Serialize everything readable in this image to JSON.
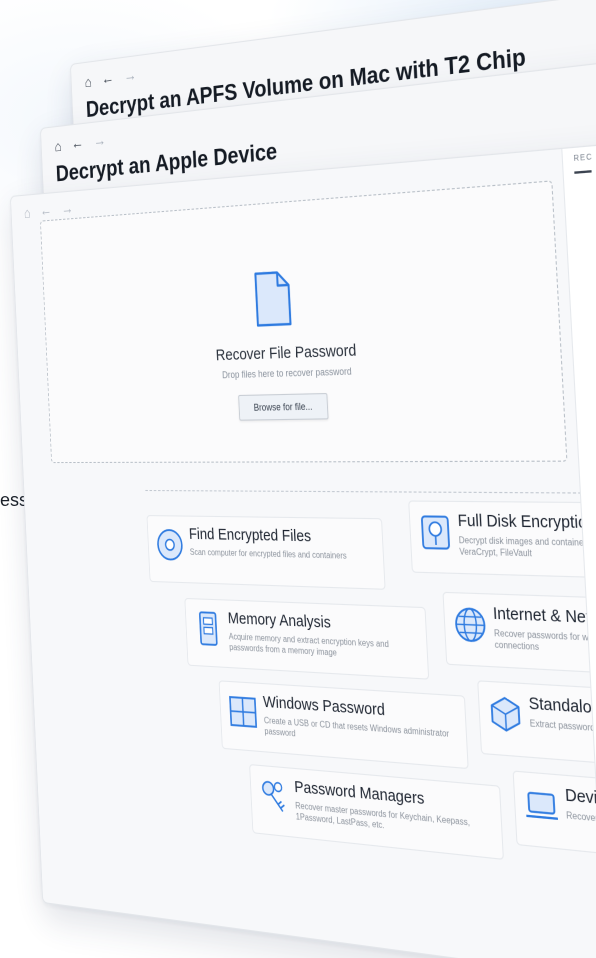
{
  "windows": [
    {
      "title": "Decrypt an APFS Volume on Mac with T2 Chip",
      "nav": {
        "home": "⌂",
        "back": "←",
        "forward": "→"
      }
    },
    {
      "title": "Decrypt an Apple Device",
      "nav": {
        "home": "⌂",
        "back": "←",
        "forward": "→"
      }
    }
  ],
  "main_window": {
    "nav": {
      "home": "⌂",
      "back": "←",
      "forward": "→"
    },
    "drop_zone": {
      "title": "Recover File Password",
      "subtitle": "Drop files here to recover password",
      "browse_label": "Browse for file..."
    },
    "right_panel_caption": "REC",
    "tiles": [
      {
        "name": "Find Encrypted Files",
        "desc": "Scan computer for encrypted files and containers",
        "icon": "disc-icon"
      },
      {
        "name": "Full Disk Encryption",
        "desc": "Decrypt disk images and containers: BitLocker, VeraCrypt, FileVault",
        "icon": "disk-lock-icon"
      },
      {
        "name": "Memory Analysis",
        "desc": "Acquire memory and extract encryption keys and passwords from a memory image",
        "icon": "memory-chip-icon"
      },
      {
        "name": "Internet & Network",
        "desc": "Recover passwords for web browsers and network connections",
        "icon": "globe-icon"
      },
      {
        "name": "Windows Password",
        "desc": "Create a USB or CD that resets Windows administrator password",
        "icon": "windows-icon"
      },
      {
        "name": "Standalone",
        "desc": "Extract passwords from external media",
        "icon": "cube-icon"
      },
      {
        "name": "Password Managers",
        "desc": "Recover master passwords for Keychain, Keepass, 1Password, LastPass, etc.",
        "icon": "keys-icon"
      },
      {
        "name": "Devices",
        "desc": "Recover data from Windows",
        "icon": "laptop-icon"
      }
    ]
  },
  "left_text": "essing",
  "colors": {
    "accent": "#2f7be0",
    "accent_light": "#dbe8fb",
    "window_bg": "#f6f7f9"
  }
}
